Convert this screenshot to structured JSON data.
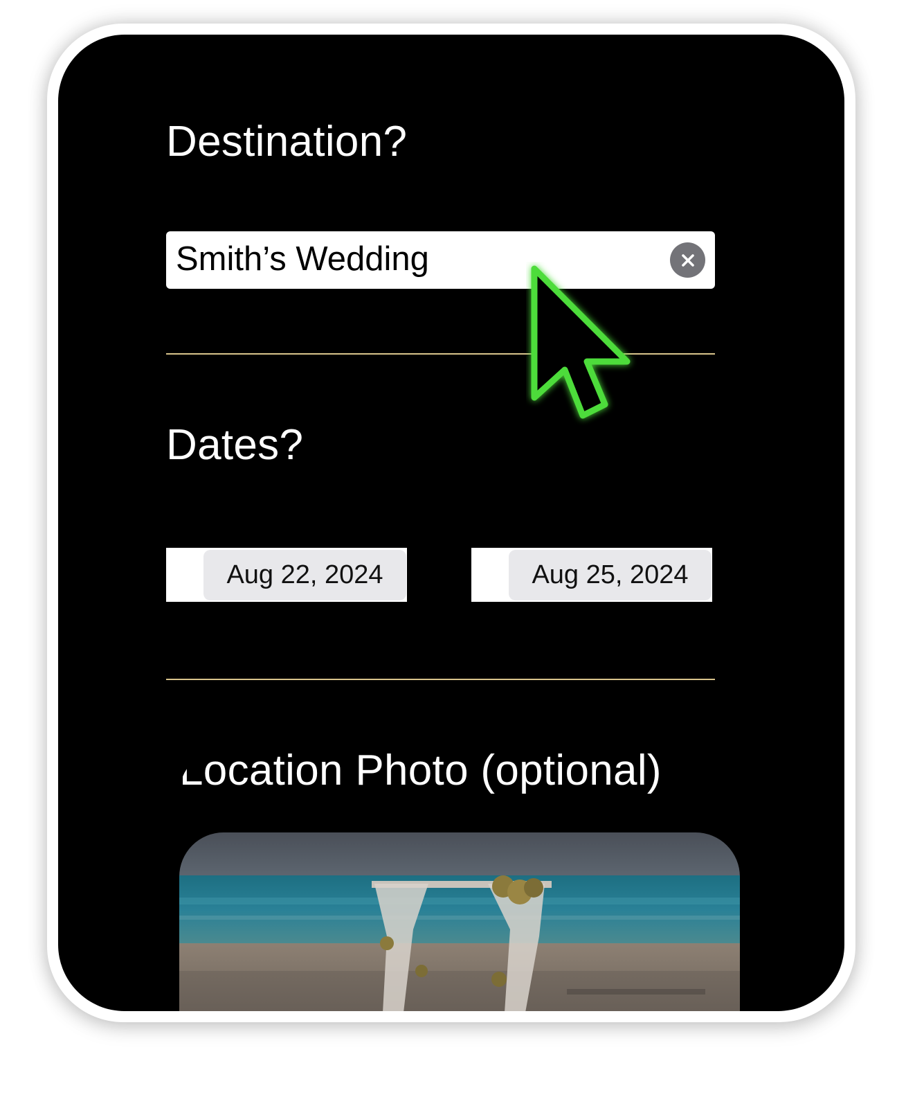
{
  "form": {
    "destination_label": "Destination?",
    "destination_value": "Smith’s Wedding",
    "dates_label": "Dates?",
    "start_date": "Aug 22, 2024",
    "end_date": "Aug 25, 2024",
    "photo_label": "Location Photo (optional)"
  },
  "colors": {
    "background": "#000000",
    "divider": "#d9c48c",
    "cursor": "#4ddc3a",
    "clear_button": "#737378"
  },
  "icons": {
    "clear": "clear-icon",
    "cursor": "mouse-pointer"
  }
}
